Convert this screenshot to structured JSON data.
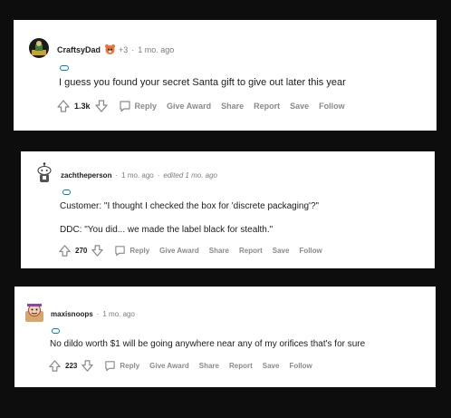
{
  "comments": [
    {
      "username": "CraftsyDad",
      "award_count": "+3",
      "time": "1 mo. ago",
      "edited": "",
      "lines": [
        "I guess you found your secret Santa gift to give out later this year"
      ],
      "score": "1.3k",
      "actions": {
        "reply": "Reply",
        "give_award": "Give Award",
        "share": "Share",
        "report": "Report",
        "save": "Save",
        "follow": "Follow"
      }
    },
    {
      "username": "zachtheperson",
      "time": "1 mo. ago",
      "edited": "edited 1 mo. ago",
      "lines": [
        "Customer: \"I thought I checked the box for 'discrete packaging'?\"",
        "DDC: \"You did... we made the label black for stealth.\""
      ],
      "score": "270",
      "actions": {
        "reply": "Reply",
        "give_award": "Give Award",
        "share": "Share",
        "report": "Report",
        "save": "Save",
        "follow": "Follow"
      }
    },
    {
      "username": "maxisnoops",
      "time": "1 mo. ago",
      "edited": "",
      "lines": [
        "No dildo worth $1 will be going anywhere near any of my orifices that's for sure"
      ],
      "score": "223",
      "actions": {
        "reply": "Reply",
        "give_award": "Give Award",
        "share": "Share",
        "report": "Report",
        "save": "Save",
        "follow": "Follow"
      }
    }
  ],
  "colors": {
    "background": "#0d0d0d",
    "card": "#ffffff",
    "text": "#1c1c1c",
    "muted": "#878a8c",
    "accent": "#0079d3"
  },
  "icons": [
    "upvote-icon",
    "downvote-icon",
    "reply-bubble-icon",
    "award-icon",
    "avatar-icon"
  ]
}
